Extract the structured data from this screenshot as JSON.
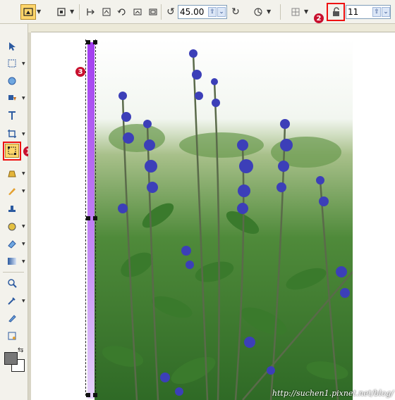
{
  "toolbar": {
    "rotation_angle": "45.00",
    "lock_value": "11",
    "tools": [
      {
        "icon": "transform-selection-icon",
        "active": true
      },
      {
        "icon": "crop-area-icon"
      },
      {
        "icon": "flip-horizontal-icon"
      },
      {
        "icon": "flip-vertical-icon"
      },
      {
        "icon": "rotate-left-icon"
      },
      {
        "icon": "rotate-right-icon"
      },
      {
        "icon": "distort-icon"
      },
      {
        "icon": "rotate-ccw-icon"
      },
      {
        "icon": "rotate-cw-icon"
      },
      {
        "icon": "reset-transform-icon"
      },
      {
        "icon": "grid-options-icon"
      },
      {
        "icon": "padlock-icon"
      }
    ]
  },
  "toolbox": {
    "tools": [
      {
        "name": "pick-tool-icon"
      },
      {
        "name": "selection-tool-icon"
      },
      {
        "name": "shape-tool-icon"
      },
      {
        "name": "text-tool-icon"
      },
      {
        "name": "crop-tool-icon"
      },
      {
        "name": "transform-tool-icon",
        "active": true
      },
      {
        "name": "fill-tool-icon"
      },
      {
        "name": "brush-tool-icon"
      },
      {
        "name": "stamp-tool-icon"
      },
      {
        "name": "blend-tool-icon"
      },
      {
        "name": "eraser-tool-icon"
      },
      {
        "name": "gradient-tool-icon"
      },
      {
        "name": "zoom-tool-icon"
      },
      {
        "name": "eyedropper-tool-icon"
      },
      {
        "name": "pen-tool-icon"
      },
      {
        "name": "node-tool-icon"
      }
    ],
    "foreground_color": "#777777",
    "background_color": "#ffffff"
  },
  "annotations": {
    "callout_1": "1",
    "callout_2": "2",
    "callout_3": "3",
    "highlight_color": "#ee1111",
    "badge_color": "#c8102e"
  },
  "canvas": {
    "watermark": "http://suchen1.pixnet.net/blog/",
    "gradient_top_color": "#a23cf0",
    "gradient_bottom_color": "#e6d3fa"
  }
}
